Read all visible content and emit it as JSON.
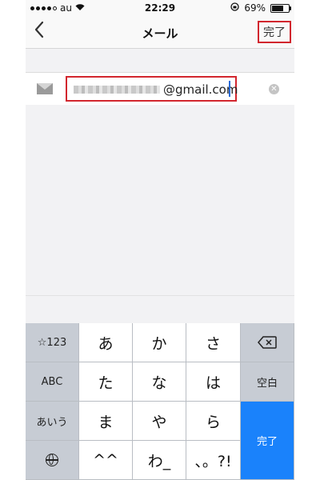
{
  "status_bar": {
    "carrier": "au",
    "time": "22:29",
    "battery_percent": "69%",
    "battery_level": 0.69,
    "icons": [
      "signal-dots-icon",
      "wifi-icon",
      "orientation-lock-icon",
      "battery-icon"
    ]
  },
  "nav": {
    "title": "メール",
    "back_icon": "chevron-left-icon",
    "done_label": "完了"
  },
  "email_field": {
    "icon": "mail-icon",
    "value_visible": "@gmail.com",
    "local_part_obscured": true,
    "clear_icon": "clear-icon"
  },
  "keyboard": {
    "rows": [
      {
        "left": "☆123",
        "keys": [
          "あ",
          "か",
          "さ"
        ],
        "right_icon": "backspace-icon"
      },
      {
        "left": "ABC",
        "keys": [
          "た",
          "な",
          "は"
        ],
        "right": "空白"
      },
      {
        "left": "あいう",
        "keys": [
          "ま",
          "や",
          "ら"
        ],
        "right": "完了"
      },
      {
        "left_icon": "globe-icon",
        "keys": [
          "^^",
          "わ_",
          "、。?!"
        ]
      }
    ]
  },
  "colors": {
    "highlight_red": "#d2262e",
    "return_key_blue": "#1a82fb",
    "cursor_blue": "#2b6cd8"
  }
}
